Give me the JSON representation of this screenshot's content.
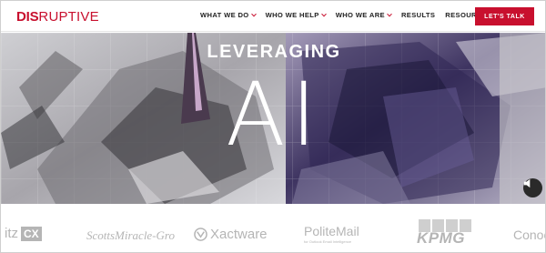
{
  "brand": {
    "logo_part1": "DIS",
    "logo_part2": "RUPTIVE"
  },
  "nav": {
    "items": [
      {
        "label": "WHAT WE DO",
        "has_dropdown": true
      },
      {
        "label": "WHO WE HELP",
        "has_dropdown": true
      },
      {
        "label": "WHO WE ARE",
        "has_dropdown": true
      },
      {
        "label": "RESULTS",
        "has_dropdown": false
      },
      {
        "label": "RESOURCES",
        "has_dropdown": true
      }
    ],
    "cta_label": "LET'S TALK"
  },
  "hero": {
    "subtitle": "LEVERAGING",
    "title": "AI",
    "sound_icon": "speaker-icon"
  },
  "clients": {
    "logos": [
      {
        "text": "itz",
        "box": "CX"
      },
      {
        "text": "ScottsMiracle-Gro"
      },
      {
        "text": "Xactware"
      },
      {
        "text": "PoliteMail",
        "tagline": "for Outlook Email Intelligence"
      },
      {
        "text": "KPMG"
      },
      {
        "text": "Conoc"
      }
    ]
  },
  "colors": {
    "brand_red": "#c8102e",
    "text_dark": "#222222",
    "client_grey": "#b5b5b5"
  }
}
